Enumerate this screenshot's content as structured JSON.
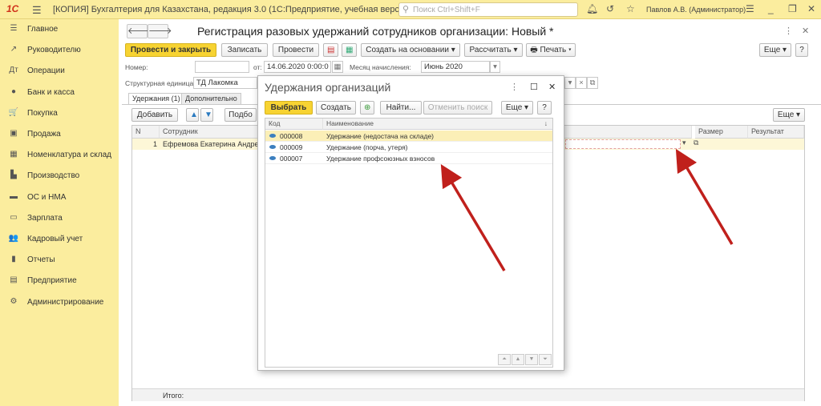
{
  "app": {
    "logo": "1С",
    "title": "[КОПИЯ] Бухгалтерия для Казахстана, редакция 3.0  (1С:Предприятие, учебная версия)",
    "search_placeholder": "Поиск Ctrl+Shift+F",
    "user": "Павлов А.В. (Администратор)"
  },
  "sidebar": {
    "items": [
      {
        "label": "Главное",
        "icon": "menu-icon",
        "glyph": "☰"
      },
      {
        "label": "Руководителю",
        "icon": "trend-icon",
        "glyph": "↗"
      },
      {
        "label": "Операции",
        "icon": "dt-kt-icon",
        "glyph": "Дт"
      },
      {
        "label": "Банк и касса",
        "icon": "bank-icon",
        "glyph": "●"
      },
      {
        "label": "Покупка",
        "icon": "cart-icon",
        "glyph": "🛒"
      },
      {
        "label": "Продажа",
        "icon": "bag-icon",
        "glyph": "▣"
      },
      {
        "label": "Номенклатура и склад",
        "icon": "warehouse-icon",
        "glyph": "▦"
      },
      {
        "label": "Производство",
        "icon": "factory-icon",
        "glyph": "▙"
      },
      {
        "label": "ОС и НМА",
        "icon": "truck-icon",
        "glyph": "▬"
      },
      {
        "label": "Зарплата",
        "icon": "wallet-icon",
        "glyph": "▭"
      },
      {
        "label": "Кадровый учет",
        "icon": "people-icon",
        "glyph": "👥"
      },
      {
        "label": "Отчеты",
        "icon": "bar-chart-icon",
        "glyph": "▮"
      },
      {
        "label": "Предприятие",
        "icon": "org-icon",
        "glyph": "▤"
      },
      {
        "label": "Администрирование",
        "icon": "gear-icon",
        "glyph": "⚙"
      }
    ]
  },
  "form": {
    "title": "Регистрация разовых удержаний сотрудников организации: Новый *",
    "toolbar": {
      "post_close": "Провести и закрыть",
      "save": "Записать",
      "post": "Провести",
      "create_based": "Создать на основании",
      "calculate": "Рассчитать",
      "print": "Печать",
      "more": "Еще"
    },
    "fields": {
      "number_label": "Номер:",
      "number_value": "",
      "date_label": "от:",
      "date_value": "14.06.2020  0:00:0",
      "month_label": "Месяц начисления:",
      "month_value": "Июнь 2020",
      "unit_label": "Структурная единица:",
      "unit_value": "ТД Лакомка"
    },
    "tabs": [
      "Удержания (1)",
      "Дополнительно"
    ],
    "table_toolbar": {
      "add": "Добавить",
      "pick": "Подбо",
      "more": "Еще"
    },
    "columns": {
      "n": "N",
      "employee": "Сотрудник",
      "size": "Размер",
      "result": "Результат"
    },
    "rows": [
      {
        "n": "1",
        "employee": "Ефремова Екатерина Андреевна"
      }
    ],
    "footer": "Итого:"
  },
  "dialog": {
    "title": "Удержания организаций",
    "select": "Выбрать",
    "create": "Создать",
    "find": "Найти...",
    "cancel_search": "Отменить поиск",
    "more": "Еще",
    "help": "?",
    "columns": {
      "code": "Код",
      "name": "Наименование"
    },
    "rows": [
      {
        "code": "000008",
        "name": "Удержание (недостача на складе)"
      },
      {
        "code": "000009",
        "name": "Удержание (порча, утеря)"
      },
      {
        "code": "000007",
        "name": "Удержание профсоюзных взносов"
      }
    ]
  },
  "colors": {
    "accent": "#f7d332",
    "sidebar": "#fbed9e",
    "arrow": "#c0201c"
  }
}
